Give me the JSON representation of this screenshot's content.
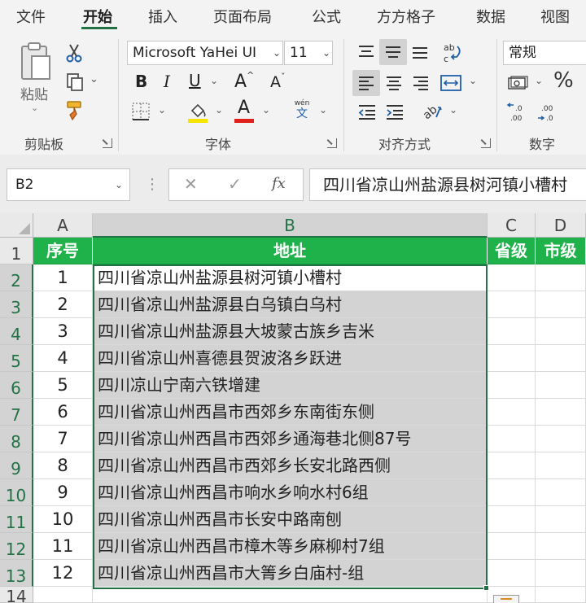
{
  "ribbon_tabs": [
    "文件",
    "开始",
    "插入",
    "页面布局",
    "公式",
    "方方格子",
    "数据",
    "视图"
  ],
  "active_tab": "开始",
  "clipboard": {
    "paste_label": "粘贴",
    "group_label": "剪贴板"
  },
  "font": {
    "name": "Microsoft YaHei UI",
    "size": "11",
    "group_label": "字体",
    "bold": "B",
    "italic": "I",
    "underline": "U",
    "grow": "A",
    "shrink": "A",
    "font_color_letter": "A",
    "phonetic_top": "wén",
    "phonetic_bottom": "文"
  },
  "alignment": {
    "group_label": "对齐方式"
  },
  "number": {
    "format": "常规",
    "group_label": "数字",
    "percent": "%"
  },
  "formula_bar": {
    "name_box": "B2",
    "cancel": "✕",
    "enter": "✓",
    "fx": "fx",
    "content": "四川省凉山州盐源县树河镇小槽村"
  },
  "columns": [
    "A",
    "B",
    "C",
    "D"
  ],
  "rows": [
    "1",
    "2",
    "3",
    "4",
    "5",
    "6",
    "7",
    "8",
    "9",
    "10",
    "11",
    "12",
    "13",
    "14"
  ],
  "table": {
    "headers": [
      "序号",
      "地址",
      "省级",
      "市级"
    ],
    "records": [
      {
        "no": "1",
        "address": "四川省凉山州盐源县树河镇小槽村"
      },
      {
        "no": "2",
        "address": "四川省凉山州盐源县白乌镇白乌村"
      },
      {
        "no": "3",
        "address": "四川省凉山州盐源县大坡蒙古族乡吉米"
      },
      {
        "no": "4",
        "address": "四川省凉山州喜德县贺波洛乡跃进"
      },
      {
        "no": "5",
        "address": "四川凉山宁南六铁增建"
      },
      {
        "no": "6",
        "address": "四川省凉山州西昌市西郊乡东南街东侧"
      },
      {
        "no": "7",
        "address": "四川省凉山州西昌市西郊乡通海巷北侧87号"
      },
      {
        "no": "8",
        "address": "四川省凉山州西昌市西郊乡长安北路西侧"
      },
      {
        "no": "9",
        "address": "四川省凉山州西昌市响水乡响水村6组"
      },
      {
        "no": "10",
        "address": "四川省凉山州西昌市长安中路南刨"
      },
      {
        "no": "11",
        "address": "四川省凉山州西昌市樟木等乡麻柳村7组"
      },
      {
        "no": "12",
        "address": "四川省凉山州西昌市大箐乡白庙村-组"
      }
    ]
  },
  "colors": {
    "accent": "#217346",
    "header_fill": "#1fb14a",
    "selection_fill": "#d3d3d3",
    "highlight_yellow": "#f5e400",
    "font_red": "#e0201b"
  }
}
